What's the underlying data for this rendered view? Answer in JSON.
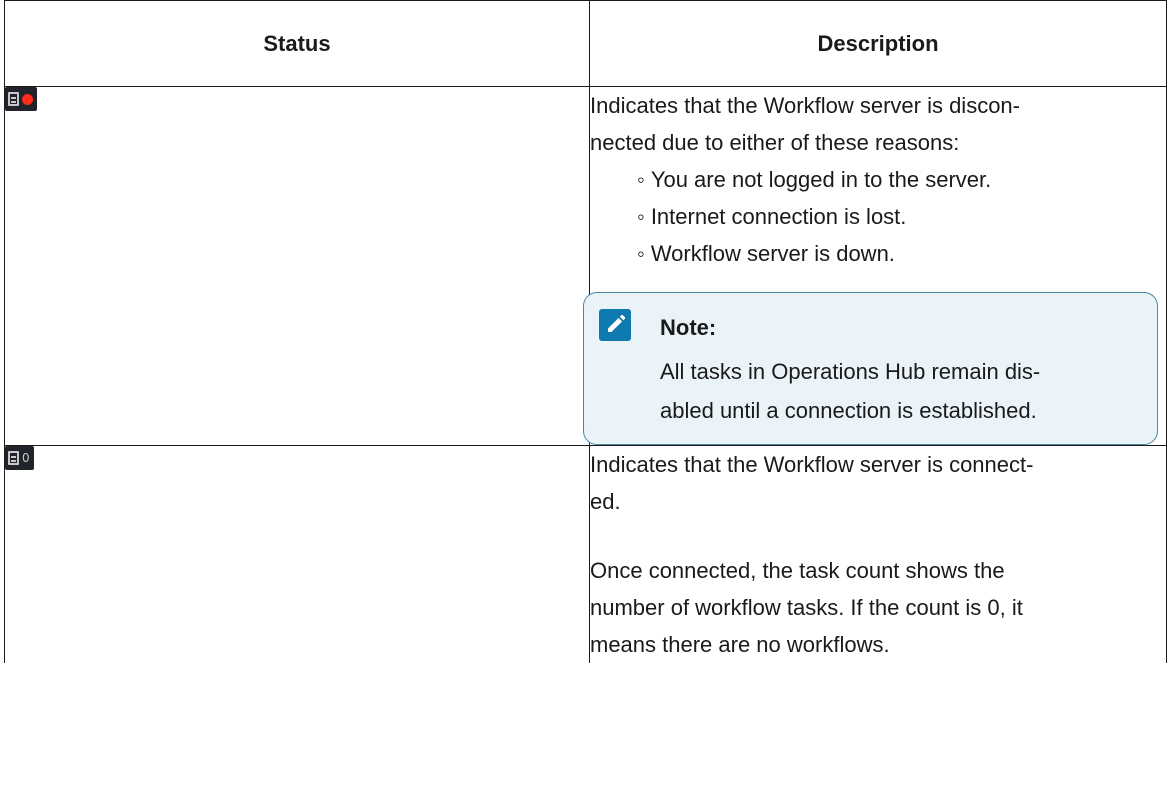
{
  "table": {
    "headers": {
      "status": "Status",
      "description": "Description"
    },
    "rows": [
      {
        "status_icon": "server-icon-with-red-dot",
        "status_indicator_color": "#ff2d1f",
        "line1": "Indicates that the Workflow server is discon-",
        "line2": "nected due to either of these reasons:",
        "reasons": [
          "You are not logged in to the server.",
          "Internet connection is lost.",
          "Workflow server is down."
        ],
        "note": {
          "title": "Note:",
          "line1": "All tasks in Operations Hub remain dis-",
          "line2": "abled until a connection is established."
        }
      },
      {
        "status_icon": "server-icon-with-count",
        "task_count": "0",
        "line1": "Indicates that the Workflow server is connect-",
        "line2": "ed.",
        "para2_line1": "Once connected, the task count shows the",
        "para2_line2": "number of workflow tasks. If the count is 0, it",
        "para2_line3": "means there are no workflows."
      }
    ]
  },
  "colors": {
    "note_background": "#eaf3f8",
    "note_border": "#4a86a8",
    "note_icon": "#0e7ab0",
    "icon_background": "#202329"
  }
}
